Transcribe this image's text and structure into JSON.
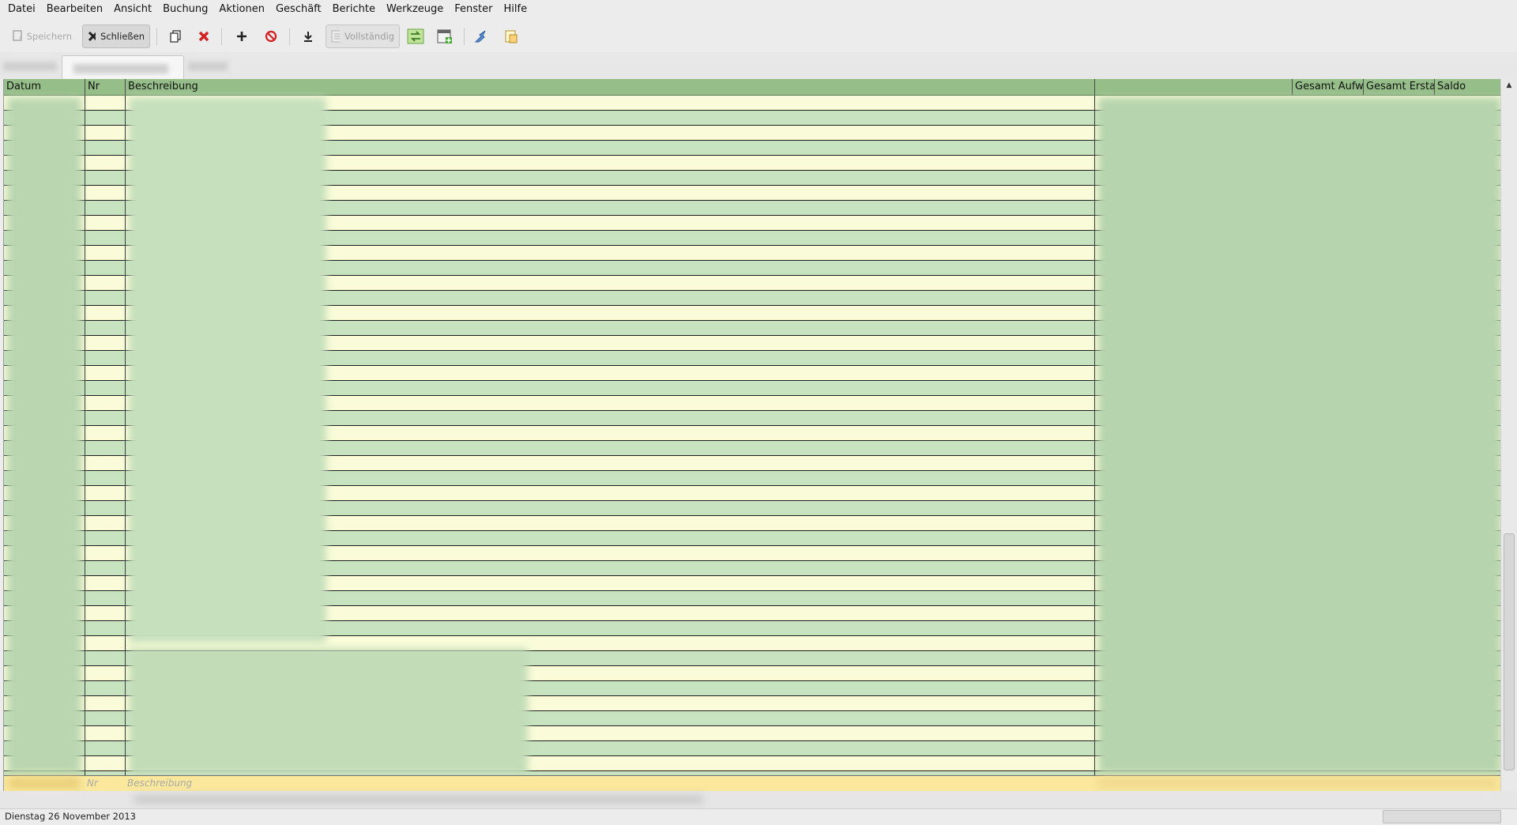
{
  "menu": [
    "Datei",
    "Bearbeiten",
    "Ansicht",
    "Buchung",
    "Aktionen",
    "Geschäft",
    "Berichte",
    "Werkzeuge",
    "Fenster",
    "Hilfe"
  ],
  "toolbar": {
    "save_label": "Speichern",
    "close_label": "Schließen",
    "view_label": "Vollständig",
    "icons": [
      "save-icon",
      "close-icon",
      "duplicate-icon",
      "delete-icon",
      "add-icon",
      "void-icon",
      "download-icon",
      "view-icon",
      "refresh-icon",
      "calendar-icon",
      "reconcile-icon",
      "split-icon"
    ]
  },
  "register": {
    "columns": {
      "date": "Datum",
      "num": "Nr",
      "description": "Beschreibung",
      "transfer": "",
      "total_expense": "Gesamt Aufw",
      "total_refund": "Gesamt Ersta",
      "balance": "Saldo"
    },
    "blank_row": {
      "num_placeholder": "Nr",
      "description_placeholder": "Beschreibung"
    },
    "colors": {
      "header": "#96be89",
      "row_light": "#fafcd9",
      "row_green": "#c7e3bf",
      "blank_row": "#fbe89c"
    }
  },
  "status": {
    "date_text": "Dienstag 26 November 2013"
  }
}
